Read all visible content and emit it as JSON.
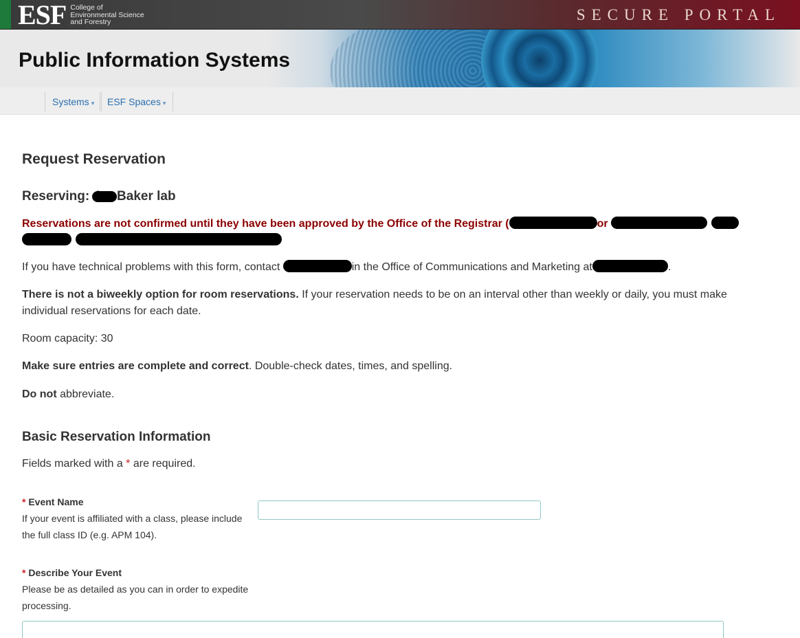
{
  "header": {
    "logo_mark": "ESF",
    "logo_lines": [
      "College of",
      "Environmental Science",
      "and Forestry"
    ],
    "portal_label": "SECURE PORTAL"
  },
  "banner": {
    "title": "Public Information Systems"
  },
  "nav": {
    "items": [
      {
        "label": "Systems",
        "caret": "▾"
      },
      {
        "label": "ESF Spaces",
        "caret": "▾"
      }
    ]
  },
  "main": {
    "heading": "Request Reservation",
    "reserving_prefix": "Reserving: 4",
    "reserving_room": "Baker lab",
    "warning_text": "Reservations are not confirmed until they have been approved by the Office of the Registrar (",
    "warning_or": "or",
    "tech_prefix": "If you have technical problems with this form, contact",
    "tech_middle": "in the Office of Communications and Marketing at",
    "tech_suffix": ".",
    "biweekly_bold": "There is not a biweekly option for room reservations.",
    "biweekly_rest": " If your reservation needs to be on an interval other than weekly or daily, you must make individual reservations for each date.",
    "capacity": "Room capacity: 30",
    "sure_bold": "Make sure entries are complete and correct",
    "sure_rest": ". Double-check dates, times, and spelling.",
    "abbrev_bold": "Do not",
    "abbrev_rest": " abbreviate.",
    "section_heading": "Basic Reservation Information",
    "fields_prefix": "Fields marked with a ",
    "required_mark": "*",
    "fields_suffix": " are required."
  },
  "form": {
    "event_name": {
      "label": "Event Name",
      "help": "If your event is affiliated with a class, please include the full class ID (e.g. APM 104).",
      "value": ""
    },
    "describe_event": {
      "label": "Describe Your Event",
      "help": "Please be as detailed as you can in order to expedite processing.",
      "value": ""
    }
  },
  "colors": {
    "warning": "#8b0000",
    "link": "#2a6fb0",
    "required": "#cc2222",
    "input_border": "#8fc7c4"
  }
}
